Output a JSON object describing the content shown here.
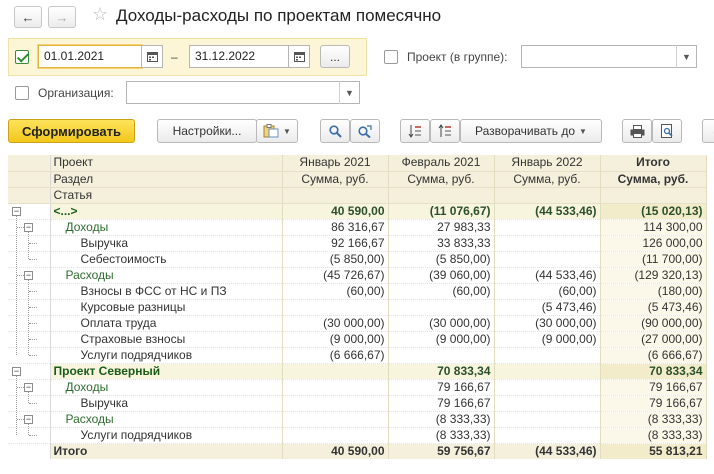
{
  "window": {
    "title": "Доходы-расходы по проектам помесячно"
  },
  "nav": {
    "back": "←",
    "forward": "→",
    "star": "☆"
  },
  "filters": {
    "period_enabled": true,
    "date_from": "01.01.2021",
    "dash": "–",
    "date_to": "31.12.2022",
    "more": "...",
    "project_label": "Проект (в группе):",
    "project_value": "",
    "org_label": "Организация:",
    "org_value": ""
  },
  "toolbar": {
    "generate": "Сформировать",
    "settings": "Настройки...",
    "expand": "Разворачивать до"
  },
  "table": {
    "headers": [
      [
        "Проект",
        "Январь 2021",
        "Февраль 2021",
        "Январь 2022",
        "Итого"
      ],
      [
        "Раздел",
        "Сумма, руб.",
        "Сумма, руб.",
        "Сумма, руб.",
        "Сумма, руб."
      ],
      [
        "Статья",
        "",
        "",
        "",
        ""
      ]
    ],
    "rows": [
      {
        "label": "<...>",
        "level": 0,
        "v": [
          "40 590,00",
          "(11 076,67)",
          "(44 533,46)",
          "(15 020,13)"
        ]
      },
      {
        "label": "Доходы",
        "level": 1,
        "v": [
          "86 316,67",
          "27 983,33",
          "",
          "114 300,00"
        ]
      },
      {
        "label": "Выручка",
        "level": 2,
        "v": [
          "92 166,67",
          "33 833,33",
          "",
          "126 000,00"
        ]
      },
      {
        "label": "Себестоимость",
        "level": 2,
        "v": [
          "(5 850,00)",
          "(5 850,00)",
          "",
          "(11 700,00)"
        ]
      },
      {
        "label": "Расходы",
        "level": 1,
        "v": [
          "(45 726,67)",
          "(39 060,00)",
          "(44 533,46)",
          "(129 320,13)"
        ]
      },
      {
        "label": "Взносы в ФСС от НС и ПЗ",
        "level": 2,
        "v": [
          "(60,00)",
          "(60,00)",
          "(60,00)",
          "(180,00)"
        ]
      },
      {
        "label": "Курсовые разницы",
        "level": 2,
        "v": [
          "",
          "",
          "(5 473,46)",
          "(5 473,46)"
        ]
      },
      {
        "label": "Оплата труда",
        "level": 2,
        "v": [
          "(30 000,00)",
          "(30 000,00)",
          "(30 000,00)",
          "(90 000,00)"
        ]
      },
      {
        "label": "Страховые взносы",
        "level": 2,
        "v": [
          "(9 000,00)",
          "(9 000,00)",
          "(9 000,00)",
          "(27 000,00)"
        ]
      },
      {
        "label": "Услуги подрядчиков",
        "level": 2,
        "v": [
          "(6 666,67)",
          "",
          "",
          "(6 666,67)"
        ]
      },
      {
        "label": "Проект Северный",
        "level": 0,
        "v": [
          "",
          "70 833,34",
          "",
          "70 833,34"
        ]
      },
      {
        "label": "Доходы",
        "level": 1,
        "v": [
          "",
          "79 166,67",
          "",
          "79 166,67"
        ]
      },
      {
        "label": "Выручка",
        "level": 2,
        "v": [
          "",
          "79 166,67",
          "",
          "79 166,67"
        ]
      },
      {
        "label": "Расходы",
        "level": 1,
        "v": [
          "",
          "(8 333,33)",
          "",
          "(8 333,33)"
        ]
      },
      {
        "label": "Услуги подрядчиков",
        "level": 2,
        "v": [
          "",
          "(8 333,33)",
          "",
          "(8 333,33)"
        ]
      },
      {
        "label": "Итого",
        "level": -1,
        "v": [
          "40 590,00",
          "59 756,67",
          "(44 533,46)",
          "55 813,21"
        ]
      }
    ]
  },
  "colors": {
    "accent": "#f3c71c",
    "header_bg": "#f4f0dc",
    "group_text": "#1a5c1a"
  }
}
